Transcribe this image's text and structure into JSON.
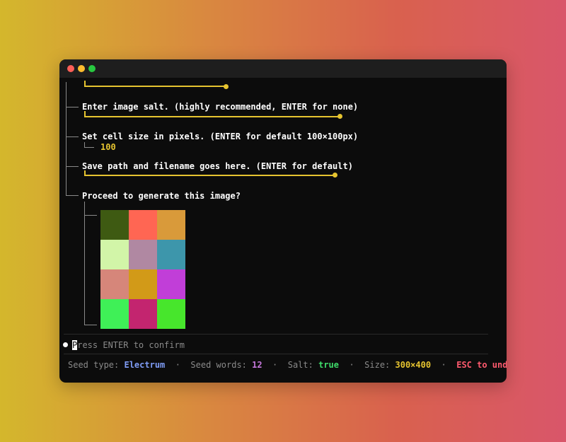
{
  "window": {
    "controls": [
      "close",
      "minimize",
      "maximize"
    ]
  },
  "steps": [
    {
      "label": "Enter image salt. (highly recommended, ",
      "key": "ENTER",
      "label_after": " for none)"
    },
    {
      "label": "Set cell size in pixels. (",
      "key": "ENTER",
      "label_after": " for default 100×100px)",
      "value": "100"
    },
    {
      "label": "Save path and filename goes here. (",
      "key": "ENTER",
      "label_after": " for default)"
    },
    {
      "label": "Proceed to generate this image?"
    }
  ],
  "preview_grid": {
    "colors": [
      "#3e5a12",
      "#ff6653",
      "#d99a3a",
      "#d2f5a8",
      "#b088a2",
      "#3d96ab",
      "#d6867a",
      "#d29a18",
      "#c13ed8",
      "#3ff057",
      "#c3256f",
      "#47e62c"
    ]
  },
  "prompt": {
    "cursor_char": "P",
    "text": "ress ENTER to confirm"
  },
  "status_bar": {
    "seed_type_label": "Seed type:",
    "seed_type_value": "Electrum",
    "seed_words_label": "Seed words:",
    "seed_words_value": "12",
    "salt_label": "Salt:",
    "salt_value": "true",
    "size_label": "Size:",
    "size_value": "300×400",
    "undo_label": "ESC to undo",
    "separator": "·",
    "colors": {
      "electrum": "#7f9cf5",
      "seed_words": "#c678dd",
      "salt": "#3fdc6a",
      "size": "#e6c430",
      "undo": "#ff5a6e"
    }
  }
}
